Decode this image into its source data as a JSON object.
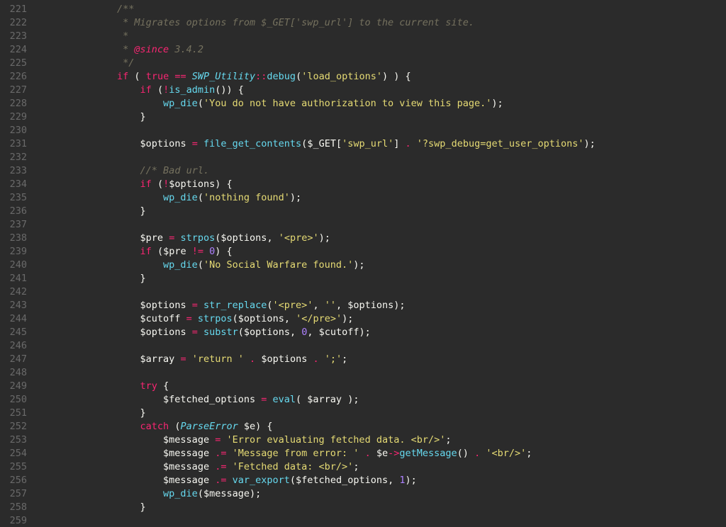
{
  "gutter": {
    "start": 221,
    "end": 259
  },
  "code": {
    "221": {
      "indent": 2,
      "segs": [
        {
          "c": "doc",
          "t": "/**"
        }
      ]
    },
    "222": {
      "indent": 2,
      "segs": [
        {
          "c": "doc",
          "t": " * Migrates options from $_GET['swp_url'] to the current site."
        }
      ]
    },
    "223": {
      "indent": 2,
      "segs": [
        {
          "c": "doc",
          "t": " *"
        }
      ]
    },
    "224": {
      "indent": 2,
      "segs": [
        {
          "c": "doc",
          "t": " * "
        },
        {
          "c": "tag",
          "t": "@since"
        },
        {
          "c": "doc",
          "t": " 3.4.2"
        }
      ]
    },
    "225": {
      "indent": 2,
      "segs": [
        {
          "c": "doc",
          "t": " */"
        }
      ]
    },
    "226": {
      "indent": 2,
      "segs": [
        {
          "c": "kw",
          "t": "if"
        },
        {
          "c": "pn",
          "t": " ( "
        },
        {
          "c": "kw",
          "t": "true"
        },
        {
          "c": "pn",
          "t": " "
        },
        {
          "c": "op",
          "t": "=="
        },
        {
          "c": "pn",
          "t": " "
        },
        {
          "c": "cls",
          "t": "SWP_Utility"
        },
        {
          "c": "op",
          "t": "::"
        },
        {
          "c": "fn",
          "t": "debug"
        },
        {
          "c": "pn",
          "t": "("
        },
        {
          "c": "str",
          "t": "'load_options'"
        },
        {
          "c": "pn",
          "t": ") ) {"
        }
      ]
    },
    "227": {
      "indent": 3,
      "segs": [
        {
          "c": "kw",
          "t": "if"
        },
        {
          "c": "pn",
          "t": " ("
        },
        {
          "c": "op",
          "t": "!"
        },
        {
          "c": "fn",
          "t": "is_admin"
        },
        {
          "c": "pn",
          "t": "()) {"
        }
      ]
    },
    "228": {
      "indent": 4,
      "segs": [
        {
          "c": "fn",
          "t": "wp_die"
        },
        {
          "c": "pn",
          "t": "("
        },
        {
          "c": "str",
          "t": "'You do not have authorization to view this page.'"
        },
        {
          "c": "pn",
          "t": ");"
        }
      ]
    },
    "229": {
      "indent": 3,
      "segs": [
        {
          "c": "pn",
          "t": "}"
        }
      ]
    },
    "230": {
      "indent": 0,
      "segs": []
    },
    "231": {
      "indent": 3,
      "segs": [
        {
          "c": "var",
          "t": "$options"
        },
        {
          "c": "pn",
          "t": " "
        },
        {
          "c": "op",
          "t": "="
        },
        {
          "c": "pn",
          "t": " "
        },
        {
          "c": "fn",
          "t": "file_get_contents"
        },
        {
          "c": "pn",
          "t": "("
        },
        {
          "c": "var",
          "t": "$_GET"
        },
        {
          "c": "pn",
          "t": "["
        },
        {
          "c": "str",
          "t": "'swp_url'"
        },
        {
          "c": "pn",
          "t": "] "
        },
        {
          "c": "op",
          "t": "."
        },
        {
          "c": "pn",
          "t": " "
        },
        {
          "c": "str",
          "t": "'?swp_debug=get_user_options'"
        },
        {
          "c": "pn",
          "t": ");"
        }
      ]
    },
    "232": {
      "indent": 0,
      "segs": []
    },
    "233": {
      "indent": 3,
      "segs": [
        {
          "c": "cm",
          "t": "//* Bad url."
        }
      ]
    },
    "234": {
      "indent": 3,
      "segs": [
        {
          "c": "kw",
          "t": "if"
        },
        {
          "c": "pn",
          "t": " ("
        },
        {
          "c": "op",
          "t": "!"
        },
        {
          "c": "var",
          "t": "$options"
        },
        {
          "c": "pn",
          "t": ") {"
        }
      ]
    },
    "235": {
      "indent": 4,
      "segs": [
        {
          "c": "fn",
          "t": "wp_die"
        },
        {
          "c": "pn",
          "t": "("
        },
        {
          "c": "str",
          "t": "'nothing found'"
        },
        {
          "c": "pn",
          "t": ");"
        }
      ]
    },
    "236": {
      "indent": 3,
      "segs": [
        {
          "c": "pn",
          "t": "}"
        }
      ]
    },
    "237": {
      "indent": 0,
      "segs": []
    },
    "238": {
      "indent": 3,
      "segs": [
        {
          "c": "var",
          "t": "$pre"
        },
        {
          "c": "pn",
          "t": " "
        },
        {
          "c": "op",
          "t": "="
        },
        {
          "c": "pn",
          "t": " "
        },
        {
          "c": "fn",
          "t": "strpos"
        },
        {
          "c": "pn",
          "t": "("
        },
        {
          "c": "var",
          "t": "$options"
        },
        {
          "c": "pn",
          "t": ", "
        },
        {
          "c": "str",
          "t": "'<pre>'"
        },
        {
          "c": "pn",
          "t": ");"
        }
      ]
    },
    "239": {
      "indent": 3,
      "segs": [
        {
          "c": "kw",
          "t": "if"
        },
        {
          "c": "pn",
          "t": " ("
        },
        {
          "c": "var",
          "t": "$pre"
        },
        {
          "c": "pn",
          "t": " "
        },
        {
          "c": "op",
          "t": "!="
        },
        {
          "c": "pn",
          "t": " "
        },
        {
          "c": "num",
          "t": "0"
        },
        {
          "c": "pn",
          "t": ") {"
        }
      ]
    },
    "240": {
      "indent": 4,
      "segs": [
        {
          "c": "fn",
          "t": "wp_die"
        },
        {
          "c": "pn",
          "t": "("
        },
        {
          "c": "str",
          "t": "'No Social Warfare found.'"
        },
        {
          "c": "pn",
          "t": ");"
        }
      ]
    },
    "241": {
      "indent": 3,
      "segs": [
        {
          "c": "pn",
          "t": "}"
        }
      ]
    },
    "242": {
      "indent": 0,
      "segs": []
    },
    "243": {
      "indent": 3,
      "segs": [
        {
          "c": "var",
          "t": "$options"
        },
        {
          "c": "pn",
          "t": " "
        },
        {
          "c": "op",
          "t": "="
        },
        {
          "c": "pn",
          "t": " "
        },
        {
          "c": "fn",
          "t": "str_replace"
        },
        {
          "c": "pn",
          "t": "("
        },
        {
          "c": "str",
          "t": "'<pre>'"
        },
        {
          "c": "pn",
          "t": ", "
        },
        {
          "c": "str",
          "t": "''"
        },
        {
          "c": "pn",
          "t": ", "
        },
        {
          "c": "var",
          "t": "$options"
        },
        {
          "c": "pn",
          "t": ");"
        }
      ]
    },
    "244": {
      "indent": 3,
      "segs": [
        {
          "c": "var",
          "t": "$cutoff"
        },
        {
          "c": "pn",
          "t": " "
        },
        {
          "c": "op",
          "t": "="
        },
        {
          "c": "pn",
          "t": " "
        },
        {
          "c": "fn",
          "t": "strpos"
        },
        {
          "c": "pn",
          "t": "("
        },
        {
          "c": "var",
          "t": "$options"
        },
        {
          "c": "pn",
          "t": ", "
        },
        {
          "c": "str",
          "t": "'</pre>'"
        },
        {
          "c": "pn",
          "t": ");"
        }
      ]
    },
    "245": {
      "indent": 3,
      "segs": [
        {
          "c": "var",
          "t": "$options"
        },
        {
          "c": "pn",
          "t": " "
        },
        {
          "c": "op",
          "t": "="
        },
        {
          "c": "pn",
          "t": " "
        },
        {
          "c": "fn",
          "t": "substr"
        },
        {
          "c": "pn",
          "t": "("
        },
        {
          "c": "var",
          "t": "$options"
        },
        {
          "c": "pn",
          "t": ", "
        },
        {
          "c": "num",
          "t": "0"
        },
        {
          "c": "pn",
          "t": ", "
        },
        {
          "c": "var",
          "t": "$cutoff"
        },
        {
          "c": "pn",
          "t": ");"
        }
      ]
    },
    "246": {
      "indent": 0,
      "segs": []
    },
    "247": {
      "indent": 3,
      "segs": [
        {
          "c": "var",
          "t": "$array"
        },
        {
          "c": "pn",
          "t": " "
        },
        {
          "c": "op",
          "t": "="
        },
        {
          "c": "pn",
          "t": " "
        },
        {
          "c": "str",
          "t": "'return '"
        },
        {
          "c": "pn",
          "t": " "
        },
        {
          "c": "op",
          "t": "."
        },
        {
          "c": "pn",
          "t": " "
        },
        {
          "c": "var",
          "t": "$options"
        },
        {
          "c": "pn",
          "t": " "
        },
        {
          "c": "op",
          "t": "."
        },
        {
          "c": "pn",
          "t": " "
        },
        {
          "c": "str",
          "t": "';'"
        },
        {
          "c": "pn",
          "t": ";"
        }
      ]
    },
    "248": {
      "indent": 0,
      "segs": []
    },
    "249": {
      "indent": 3,
      "segs": [
        {
          "c": "kw",
          "t": "try"
        },
        {
          "c": "pn",
          "t": " {"
        }
      ]
    },
    "250": {
      "indent": 4,
      "segs": [
        {
          "c": "var",
          "t": "$fetched_options"
        },
        {
          "c": "pn",
          "t": " "
        },
        {
          "c": "op",
          "t": "="
        },
        {
          "c": "pn",
          "t": " "
        },
        {
          "c": "fn",
          "t": "eval"
        },
        {
          "c": "pn",
          "t": "( "
        },
        {
          "c": "var",
          "t": "$array"
        },
        {
          "c": "pn",
          "t": " );"
        }
      ]
    },
    "251": {
      "indent": 3,
      "segs": [
        {
          "c": "pn",
          "t": "}"
        }
      ]
    },
    "252": {
      "indent": 3,
      "segs": [
        {
          "c": "kw",
          "t": "catch"
        },
        {
          "c": "pn",
          "t": " ("
        },
        {
          "c": "cls",
          "t": "ParseError"
        },
        {
          "c": "pn",
          "t": " "
        },
        {
          "c": "var",
          "t": "$e"
        },
        {
          "c": "pn",
          "t": ") {"
        }
      ]
    },
    "253": {
      "indent": 4,
      "segs": [
        {
          "c": "var",
          "t": "$message"
        },
        {
          "c": "pn",
          "t": " "
        },
        {
          "c": "op",
          "t": "="
        },
        {
          "c": "pn",
          "t": " "
        },
        {
          "c": "str",
          "t": "'Error evaluating fetched data. <br/>'"
        },
        {
          "c": "pn",
          "t": ";"
        }
      ]
    },
    "254": {
      "indent": 4,
      "segs": [
        {
          "c": "var",
          "t": "$message"
        },
        {
          "c": "pn",
          "t": " "
        },
        {
          "c": "op",
          "t": ".="
        },
        {
          "c": "pn",
          "t": " "
        },
        {
          "c": "str",
          "t": "'Message from error: '"
        },
        {
          "c": "pn",
          "t": " "
        },
        {
          "c": "op",
          "t": "."
        },
        {
          "c": "pn",
          "t": " "
        },
        {
          "c": "var",
          "t": "$e"
        },
        {
          "c": "op",
          "t": "->"
        },
        {
          "c": "fn",
          "t": "getMessage"
        },
        {
          "c": "pn",
          "t": "() "
        },
        {
          "c": "op",
          "t": "."
        },
        {
          "c": "pn",
          "t": " "
        },
        {
          "c": "str",
          "t": "'<br/>'"
        },
        {
          "c": "pn",
          "t": ";"
        }
      ]
    },
    "255": {
      "indent": 4,
      "segs": [
        {
          "c": "var",
          "t": "$message"
        },
        {
          "c": "pn",
          "t": " "
        },
        {
          "c": "op",
          "t": ".="
        },
        {
          "c": "pn",
          "t": " "
        },
        {
          "c": "str",
          "t": "'Fetched data: <br/>'"
        },
        {
          "c": "pn",
          "t": ";"
        }
      ]
    },
    "256": {
      "indent": 4,
      "segs": [
        {
          "c": "var",
          "t": "$message"
        },
        {
          "c": "pn",
          "t": " "
        },
        {
          "c": "op",
          "t": ".="
        },
        {
          "c": "pn",
          "t": " "
        },
        {
          "c": "fn",
          "t": "var_export"
        },
        {
          "c": "pn",
          "t": "("
        },
        {
          "c": "var",
          "t": "$fetched_options"
        },
        {
          "c": "pn",
          "t": ", "
        },
        {
          "c": "num",
          "t": "1"
        },
        {
          "c": "pn",
          "t": ");"
        }
      ]
    },
    "257": {
      "indent": 4,
      "segs": [
        {
          "c": "fn",
          "t": "wp_die"
        },
        {
          "c": "pn",
          "t": "("
        },
        {
          "c": "var",
          "t": "$message"
        },
        {
          "c": "pn",
          "t": ");"
        }
      ]
    },
    "258": {
      "indent": 3,
      "segs": [
        {
          "c": "pn",
          "t": "}"
        }
      ]
    },
    "259": {
      "indent": 0,
      "segs": []
    }
  }
}
